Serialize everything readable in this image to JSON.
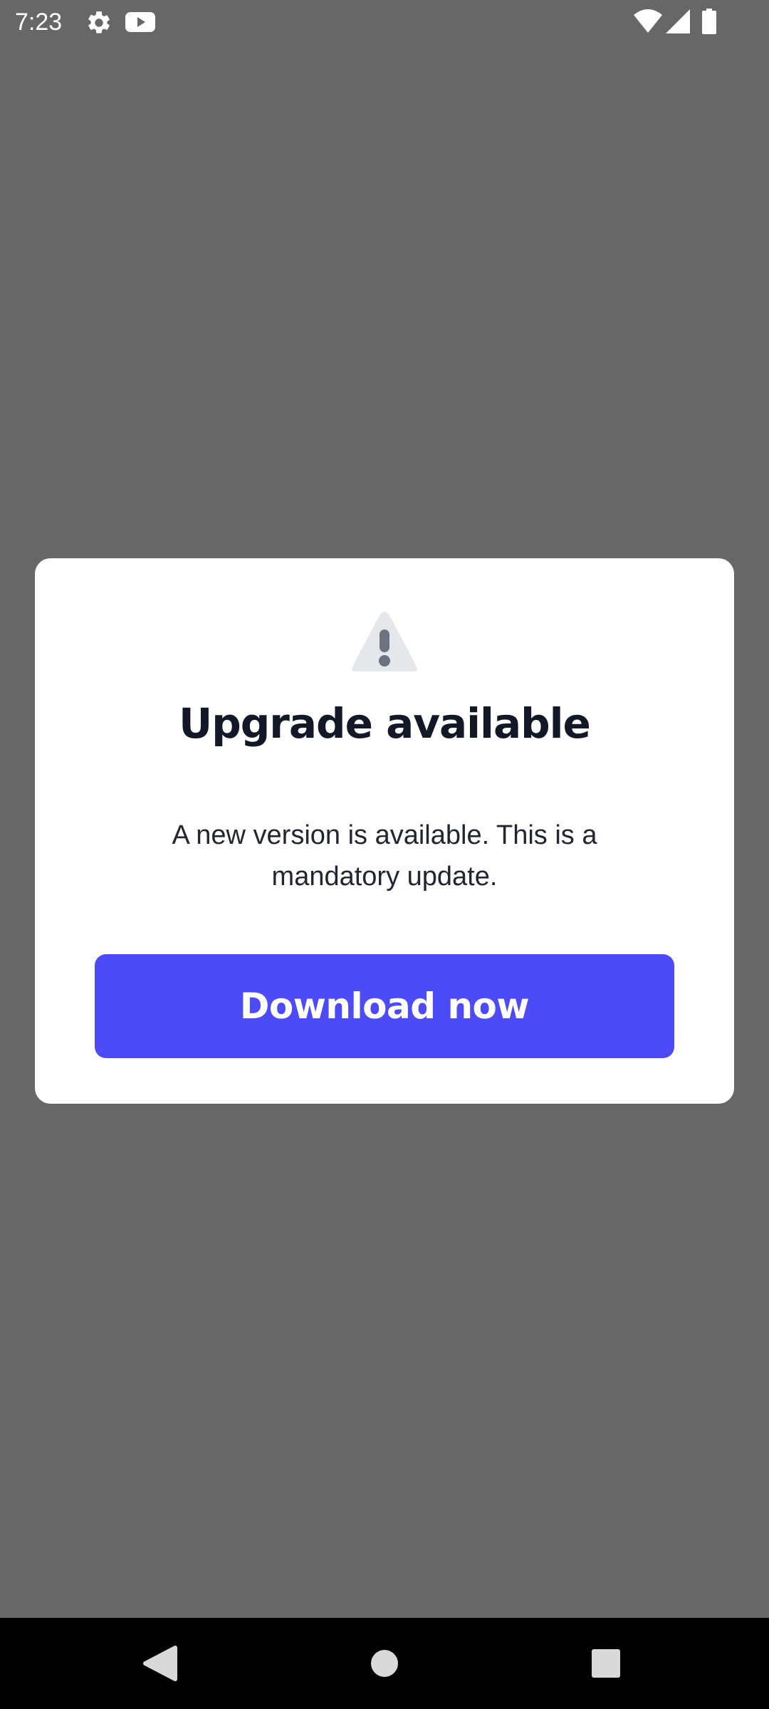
{
  "status_bar": {
    "time": "7:23",
    "left_icons": [
      "gear-icon",
      "youtube-icon"
    ],
    "right_icons": [
      "wifi-icon",
      "signal-icon",
      "battery-icon"
    ]
  },
  "dialog": {
    "icon": "warning-icon",
    "title": "Upgrade available",
    "message": "A new version is available. This is a mandatory update.",
    "primary_button_label": "Download now"
  },
  "nav_bar": {
    "buttons": [
      "back-icon",
      "home-icon",
      "recents-icon"
    ]
  },
  "colors": {
    "scrim": "#676767",
    "dialog_background": "#ffffff",
    "title": "#121826",
    "message": "#222630",
    "button": "#4c4bf7",
    "button_text": "#ffffff",
    "warning_icon_fill": "#e5e7eb",
    "warning_icon_mark": "#6b7280",
    "nav_bar": "#000000",
    "nav_icon": "#d9d9d9"
  }
}
